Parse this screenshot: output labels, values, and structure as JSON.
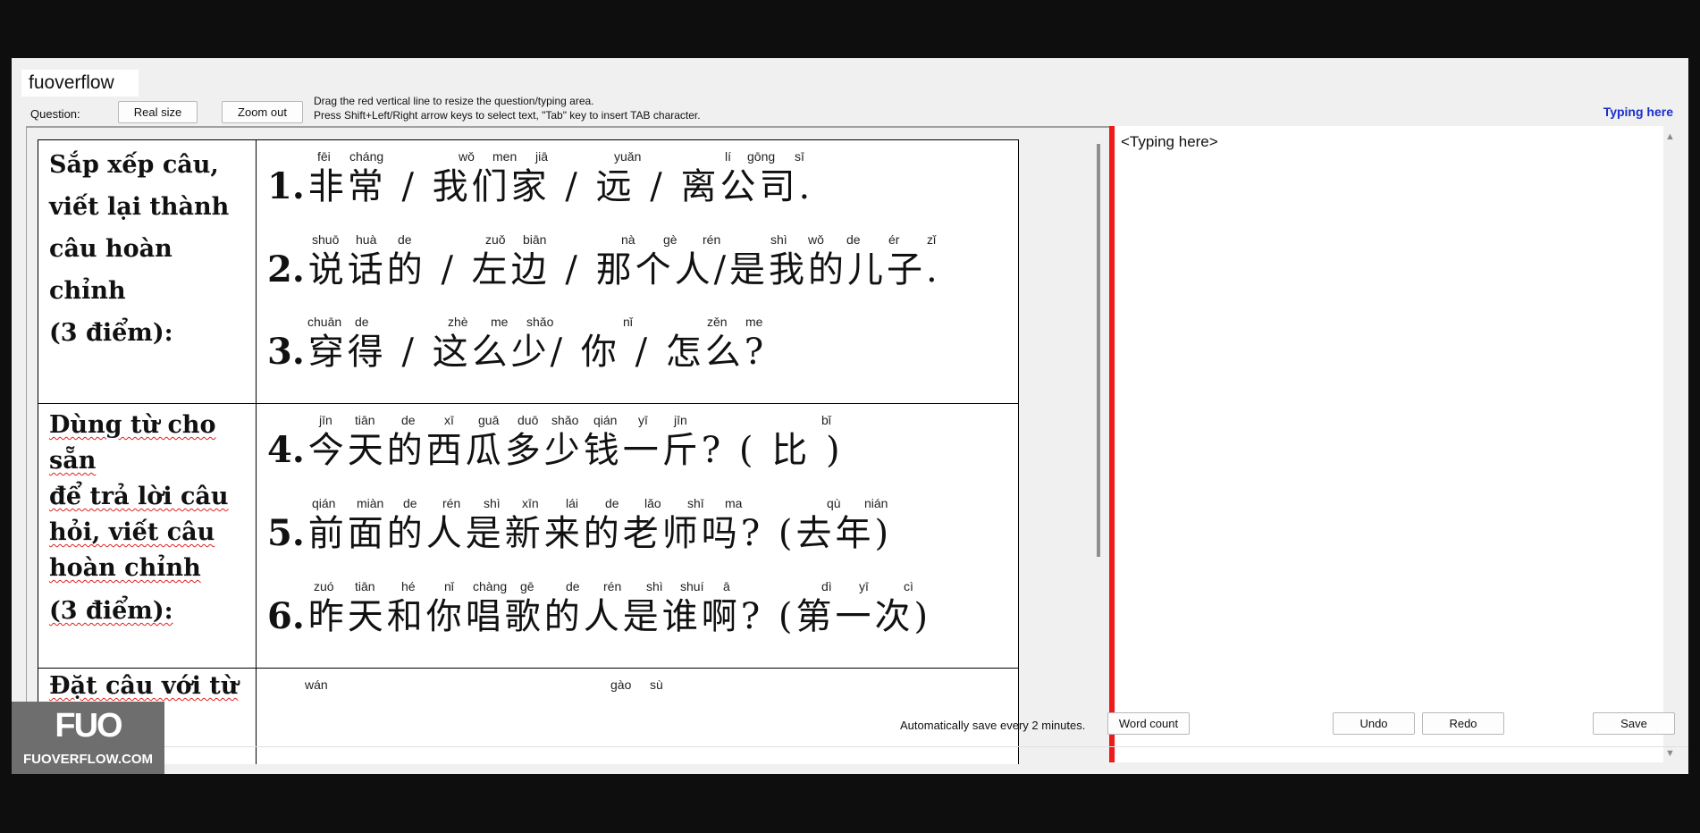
{
  "window": {
    "tab_label": "fuoverflow",
    "question_label": "Question:",
    "real_size_button": "Real size",
    "zoom_out_button": "Zoom out",
    "hint_line1": "Drag the red vertical line to resize the question/typing area.",
    "hint_line2": "Press Shift+Left/Right arrow keys to select text, \"Tab\" key to insert TAB character.",
    "typing_title": "Typing here"
  },
  "question": {
    "rows": [
      {
        "label_lines": [
          "Sắp xếp câu,",
          "viết lại thành",
          "câu hoàn chỉnh",
          "(3 điểm):"
        ],
        "items": [
          {
            "num": "1.",
            "pinyin": [
              "fēi",
              "cháng",
              "wǒ",
              "men",
              "jiā",
              "yuǎn",
              "lí",
              "gōng",
              "sī"
            ],
            "hanzi": "非常 / 我们家 / 远 / 离公司."
          },
          {
            "num": "2.",
            "pinyin": [
              "shuō",
              "huà",
              "de",
              "zuǒ",
              "biān",
              "nà",
              "gè",
              "rén",
              "shì",
              "wǒ",
              "de",
              "ér",
              "zǐ"
            ],
            "hanzi": "说话的 / 左边 / 那个人/是我的儿子."
          },
          {
            "num": "3.",
            "pinyin": [
              "chuān",
              "de",
              "zhè",
              "me",
              "shǎo",
              "nǐ",
              "zěn",
              "me"
            ],
            "hanzi": "穿得 / 这么少/ 你 / 怎么?"
          }
        ]
      },
      {
        "label_lines": [
          "Dùng từ cho sẵn",
          "để trả lời câu",
          "hỏi, viết câu",
          "hoàn chỉnh",
          "(3 điểm):"
        ],
        "items": [
          {
            "num": "4.",
            "pinyin": [
              "jīn",
              "tiān",
              "de",
              "xī",
              "guā",
              "duō",
              "shǎo",
              "qián",
              "yī",
              "jīn",
              "bǐ"
            ],
            "hanzi": "今天的西瓜多少钱一斤?  ( 比 )"
          },
          {
            "num": "5.",
            "pinyin": [
              "qián",
              "miàn",
              "de",
              "rén",
              "shì",
              "xīn",
              "lái",
              "de",
              "lǎo",
              "shī",
              "ma",
              "qù",
              "nián"
            ],
            "hanzi": "前面的人是新来的老师吗? (去年)"
          },
          {
            "num": "6.",
            "pinyin": [
              "zuó",
              "tiān",
              "hé",
              "nǐ",
              "chàng",
              "gē",
              "de",
              "rén",
              "shì",
              "shuí",
              "ā",
              "dì",
              "yī",
              "cì"
            ],
            "hanzi": "昨天和你唱歌的人是谁啊? (第一次)"
          }
        ]
      },
      {
        "label_lines": [
          "Đặt câu với từ"
        ],
        "items": [
          {
            "num": "",
            "pinyin": [
              "wán",
              "gào",
              "sù"
            ],
            "hanzi": ""
          }
        ]
      }
    ]
  },
  "typing": {
    "placeholder_text": "<Typing here>"
  },
  "footer": {
    "autosave_text": "Automatically save every 2 minutes.",
    "word_count_button": "Word count",
    "undo_button": "Undo",
    "redo_button": "Redo",
    "save_button": "Save"
  },
  "logo": {
    "mark": "FUO",
    "text": "FUOVERFLOW.COM"
  },
  "colors": {
    "divider": "#ef1b1b",
    "typing_title": "#1a2ecc",
    "spell_underline": "#e02020"
  }
}
